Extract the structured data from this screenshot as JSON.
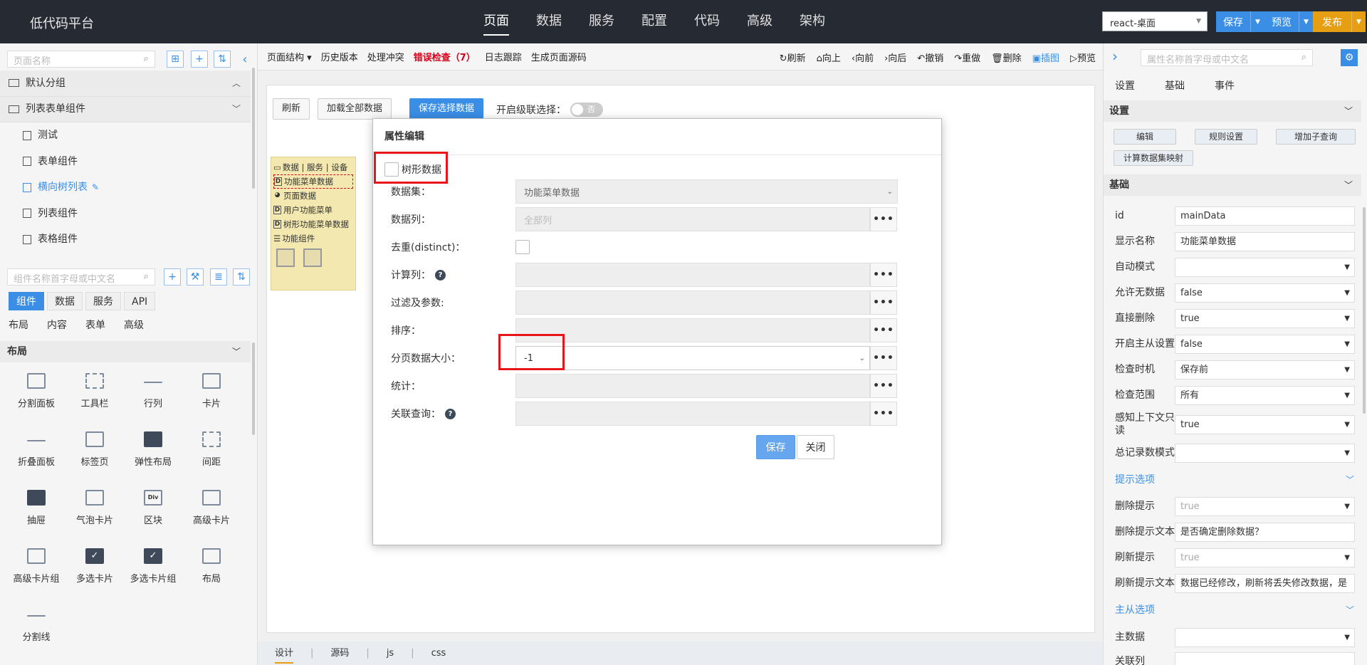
{
  "app": {
    "title": "低代码平台"
  },
  "nav": [
    "页面",
    "数据",
    "服务",
    "配置",
    "代码",
    "高级",
    "架构"
  ],
  "header": {
    "app_select": "react-桌面",
    "save": "保存",
    "preview": "预览",
    "publish": "发布"
  },
  "left": {
    "page_search_placeholder": "页面名称",
    "tree": {
      "group1": "默认分组",
      "group2": "列表表单组件",
      "items": [
        "测试",
        "表单组件",
        "横向树列表",
        "列表组件",
        "表格组件"
      ]
    },
    "comp_search_placeholder": "组件名称首字母或中文名",
    "tabs": [
      "组件",
      "数据",
      "服务",
      "API"
    ],
    "subtabs": [
      "布局",
      "内容",
      "表单",
      "高级"
    ],
    "section": "布局",
    "components": [
      "分割面板",
      "工具栏",
      "行列",
      "卡片",
      "折叠面板",
      "标签页",
      "弹性布局",
      "间距",
      "抽屉",
      "气泡卡片",
      "区块",
      "高级卡片",
      "高级卡片组",
      "多选卡片",
      "多选卡片组",
      "布局",
      "分割线"
    ]
  },
  "toolbar": {
    "left": [
      "页面结构",
      "历史版本",
      "处理冲突",
      "错误检查（7）",
      "日志跟踪",
      "生成页面源码"
    ],
    "right": [
      "刷新",
      "向上",
      "向前",
      "向后",
      "撤销",
      "重做",
      "删除",
      "插图",
      "预览"
    ]
  },
  "canvas": {
    "btn_refresh": "刷新",
    "btn_load_all": "加载全部数据",
    "btn_save_sel": "保存选择数据",
    "cascade_label": "开启级联选择：",
    "toggle_text": "否",
    "tree_header": "数据 | 服务 | 设备",
    "tree_items": [
      "功能菜单数据",
      "页面数据",
      "用户功能菜单",
      "树形功能菜单数据"
    ],
    "func_group": "功能组件"
  },
  "bottom_tabs": [
    "设计",
    "源码",
    "js",
    "css"
  ],
  "modal": {
    "title": "属性编辑",
    "tree_data_label": "树形数据",
    "dataset_label": "数据集：",
    "dataset_value": "功能菜单数据",
    "columns_label": "数据列：",
    "columns_placeholder": "全部列",
    "distinct_label": "去重(distinct)：",
    "calc_label": "计算列：",
    "filter_label": "过滤及参数:",
    "sort_label": "排序：",
    "page_size_label": "分页数据大小：",
    "page_size_value": "-1",
    "stat_label": "统计：",
    "join_label": "关联查询：",
    "dots": "•••",
    "save": "保存",
    "close": "关闭"
  },
  "right": {
    "search_placeholder": "属性名称首字母或中文名",
    "tabs": [
      "设置",
      "基础",
      "事件"
    ],
    "settings_header": "设置",
    "settings_buttons": [
      "编辑",
      "规则设置",
      "增加子查询",
      "计算数据集映射"
    ],
    "basic_header": "基础",
    "props": [
      {
        "label": "id",
        "value": "mainData"
      },
      {
        "label": "显示名称",
        "value": "功能菜单数据"
      },
      {
        "label": "自动模式",
        "value": ""
      },
      {
        "label": "允许无数据",
        "value": "false"
      },
      {
        "label": "直接删除",
        "value": "true"
      },
      {
        "label": "开启主从设置",
        "value": "false"
      },
      {
        "label": "检查时机",
        "value": "保存前"
      },
      {
        "label": "检查范围",
        "value": "所有"
      },
      {
        "label": "感知上下文只读",
        "value": "true"
      },
      {
        "label": "总记录数模式",
        "value": ""
      }
    ],
    "tips_header": "提示选项",
    "tips": [
      {
        "label": "删除提示",
        "value": "true"
      },
      {
        "label": "删除提示文本",
        "value": "是否确定删除数据？"
      },
      {
        "label": "刷新提示",
        "value": "true"
      },
      {
        "label": "刷新提示文本",
        "value": "数据已经修改，刷新将丢失修改数据，是"
      }
    ],
    "master_header": "主从选项",
    "master": [
      {
        "label": "主数据",
        "value": ""
      },
      {
        "label": "关联列",
        "value": ""
      }
    ]
  },
  "colors": {
    "topbar": "#262a33",
    "accent": "#3a8ee6",
    "publish": "#e69f13",
    "highlight": "#e8141a"
  }
}
